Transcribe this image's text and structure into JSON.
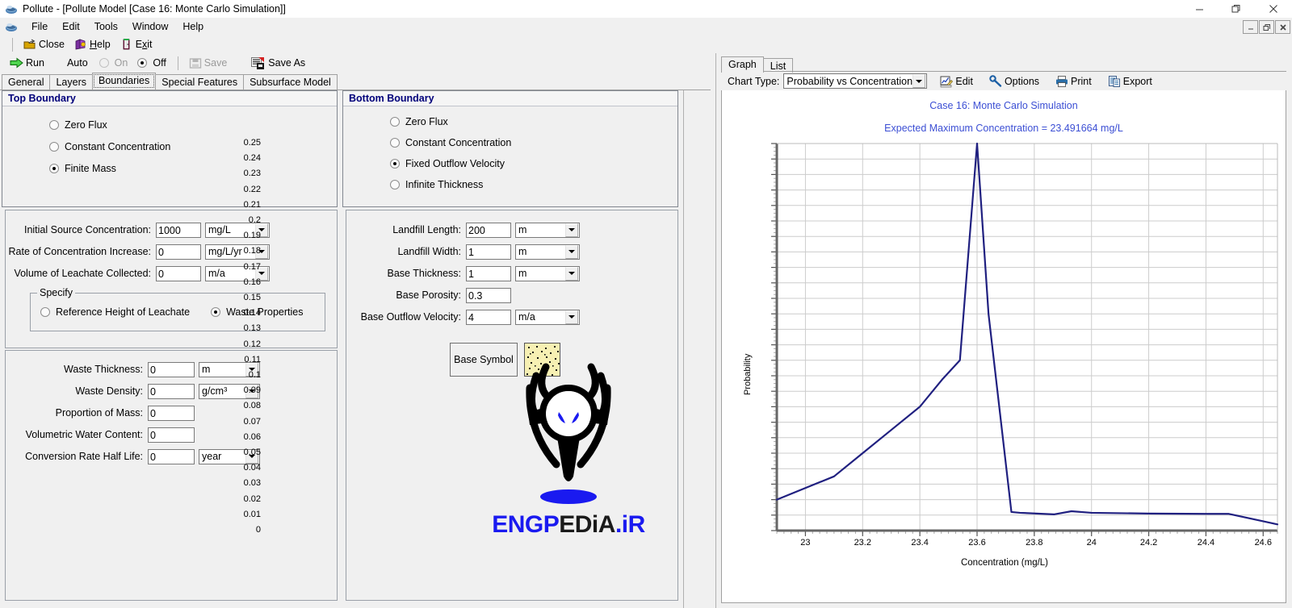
{
  "window": {
    "title": "Pollute - [Pollute Model [Case 16: Monte Carlo Simulation]]",
    "app_icon": "pollute-icon",
    "minimize": "—",
    "maximize": "❑",
    "close": "✕"
  },
  "mdi": {
    "minimize": "–",
    "restore": "❐",
    "close": "✕"
  },
  "menu": {
    "items": [
      "File",
      "Edit",
      "Tools",
      "Window",
      "Help"
    ]
  },
  "toolbar": {
    "close": "Close",
    "help": "Help",
    "exit": "Exit",
    "run": "Run",
    "auto_label": "Auto",
    "auto_on": "On",
    "auto_off": "Off",
    "save": "Save",
    "save_as": "Save As"
  },
  "tabs": {
    "items": [
      "General",
      "Layers",
      "Boundaries",
      "Special Features",
      "Subsurface Model"
    ],
    "active": "Boundaries"
  },
  "top_boundary": {
    "header": "Top Boundary",
    "options": [
      {
        "label": "Zero Flux",
        "checked": false
      },
      {
        "label": "Constant Concentration",
        "checked": false
      },
      {
        "label": "Finite Mass",
        "checked": true
      }
    ],
    "fields": [
      {
        "label": "Initial Source Concentration:",
        "value": "1000",
        "unit": "mg/L",
        "has_unit": true
      },
      {
        "label": "Rate of Concentration Increase:",
        "value": "0",
        "unit": "mg/L/yr",
        "has_unit": true
      },
      {
        "label": "Volume of Leachate Collected:",
        "value": "0",
        "unit": "m/a",
        "has_unit": true
      }
    ],
    "specify": {
      "legend": "Specify",
      "options": [
        {
          "label": "Reference Height of Leachate",
          "checked": false
        },
        {
          "label": "Waste Properties",
          "checked": true
        }
      ]
    },
    "waste_fields": [
      {
        "label": "Waste Thickness:",
        "value": "0",
        "unit": "m",
        "has_unit": true
      },
      {
        "label": "Waste Density:",
        "value": "0",
        "unit": "g/cm³",
        "has_unit": true
      },
      {
        "label": "Proportion of Mass:",
        "value": "0",
        "unit": "",
        "has_unit": false
      },
      {
        "label": "Volumetric Water Content:",
        "value": "0",
        "unit": "",
        "has_unit": false
      },
      {
        "label": "Conversion Rate Half Life:",
        "value": "0",
        "unit": "year",
        "has_unit": true
      }
    ]
  },
  "bottom_boundary": {
    "header": "Bottom Boundary",
    "options": [
      {
        "label": "Zero Flux",
        "checked": false
      },
      {
        "label": "Constant Concentration",
        "checked": false
      },
      {
        "label": "Fixed Outflow Velocity",
        "checked": true
      },
      {
        "label": "Infinite Thickness",
        "checked": false
      }
    ],
    "fields": [
      {
        "label": "Landfill Length:",
        "value": "200",
        "unit": "m",
        "has_unit": true
      },
      {
        "label": "Landfill Width:",
        "value": "1",
        "unit": "m",
        "has_unit": true
      },
      {
        "label": "Base Thickness:",
        "value": "1",
        "unit": "m",
        "has_unit": true
      },
      {
        "label": "Base Porosity:",
        "value": "0.3",
        "unit": "",
        "has_unit": false
      },
      {
        "label": "Base Outflow Velocity:",
        "value": "4",
        "unit": "m/a",
        "has_unit": true
      }
    ],
    "base_symbol_button": "Base Symbol",
    "base_symbol_color": "#f7f0b3"
  },
  "logo": {
    "part1": "ENG",
    "part2": "P",
    "part3": "EDiA",
    "part4": ".iR",
    "blue": "#1a1af0",
    "dark": "#1a1a1a"
  },
  "chart_panel": {
    "tabs": [
      "Graph",
      "List"
    ],
    "active_tab": "Graph",
    "chart_type_label": "Chart Type:",
    "chart_type_value": "Probability vs Concentration",
    "actions": [
      "Edit",
      "Options",
      "Print",
      "Export"
    ]
  },
  "chart_data": {
    "type": "line",
    "title": "Case 16: Monte Carlo Simulation",
    "subtitle": "Expected Maximum Concentration = 23.491664 mg/L",
    "xlabel": "Concentration (mg/L)",
    "ylabel": "Probability",
    "xlim": [
      22.9,
      24.65
    ],
    "ylim": [
      0,
      0.25
    ],
    "xticks": [
      23,
      23.2,
      23.4,
      23.6,
      23.8,
      24,
      24.2,
      24.4,
      24.6
    ],
    "xtick_labels": [
      "23",
      "23.2",
      "23.4",
      "23.6",
      "23.8",
      "24",
      "24.2",
      "24.4",
      "24.6"
    ],
    "yticks": [
      0,
      0.01,
      0.02,
      0.03,
      0.04,
      0.05,
      0.06,
      0.07,
      0.08,
      0.09,
      0.1,
      0.11,
      0.12,
      0.13,
      0.14,
      0.15,
      0.16,
      0.17,
      0.18,
      0.19,
      0.2,
      0.21,
      0.22,
      0.23,
      0.24,
      0.25
    ],
    "ytick_labels": [
      "0",
      "0.01",
      "0.02",
      "0.03",
      "0.04",
      "0.05",
      "0.06",
      "0.07",
      "0.08",
      "0.09",
      "0.1",
      "0.11",
      "0.12",
      "0.13",
      "0.14",
      "0.15",
      "0.16",
      "0.17",
      "0.18",
      "0.19",
      "0.2",
      "0.21",
      "0.22",
      "0.23",
      "0.24",
      "0.25"
    ],
    "grid": true,
    "legend": "none",
    "line_color": "#202080",
    "series": [
      {
        "name": "Probability",
        "x": [
          22.9,
          23.1,
          23.2,
          23.3,
          23.4,
          23.48,
          23.54,
          23.6,
          23.64,
          23.72,
          23.75,
          23.87,
          23.93,
          24.0,
          24.2,
          24.4,
          24.48,
          24.6,
          24.65
        ],
        "y": [
          0.02,
          0.035,
          0.05,
          0.065,
          0.08,
          0.098,
          0.11,
          0.25,
          0.14,
          0.012,
          0.0115,
          0.0105,
          0.0125,
          0.0115,
          0.011,
          0.0108,
          0.0108,
          0.006,
          0.004
        ]
      }
    ]
  }
}
